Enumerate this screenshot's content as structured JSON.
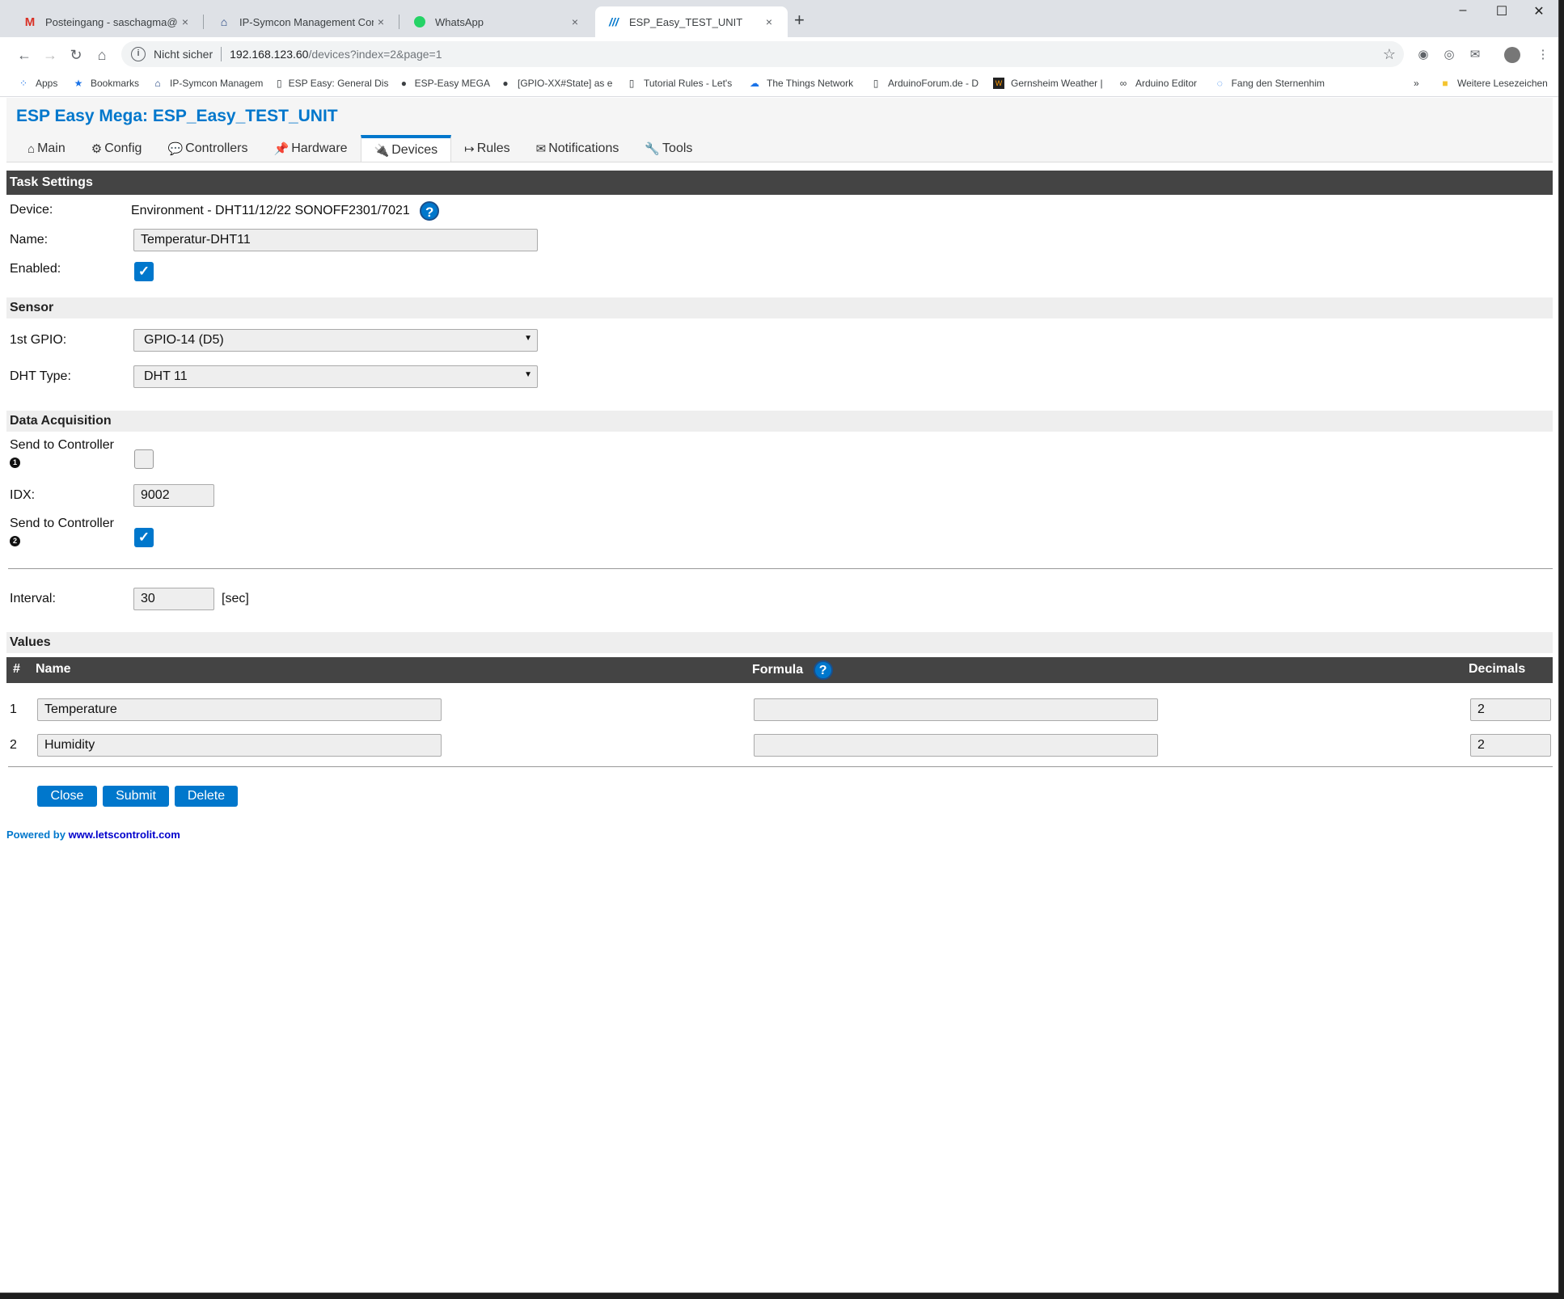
{
  "browser": {
    "tabs": [
      {
        "title": "Posteingang - saschagma@goog",
        "icon": "gmail-icon",
        "close": "×"
      },
      {
        "title": "IP-Symcon Management Console",
        "icon": "home-icon",
        "close": "×"
      },
      {
        "title": "WhatsApp",
        "icon": "whatsapp-icon",
        "close": "×"
      },
      {
        "title": "ESP_Easy_TEST_UNIT",
        "icon": "esp-icon",
        "close": "×"
      }
    ],
    "new_tab": "+",
    "address": {
      "security_label": "Nicht sicher",
      "host": "192.168.123.60",
      "path": "/devices?index=2&page=1"
    },
    "bookmarks": [
      {
        "label": "Apps",
        "icon": "apps-icon"
      },
      {
        "label": "Bookmarks",
        "icon": "star-icon"
      },
      {
        "label": "IP-Symcon Managem",
        "icon": "home-icon"
      },
      {
        "label": "ESP Easy: General Dis",
        "icon": "page-icon"
      },
      {
        "label": "ESP-Easy MEGA",
        "icon": "github-icon"
      },
      {
        "label": "[GPIO-XX#State] as e",
        "icon": "github-icon"
      },
      {
        "label": "Tutorial Rules - Let's",
        "icon": "page-icon"
      },
      {
        "label": "The Things Network",
        "icon": "cloud-icon"
      },
      {
        "label": "ArduinoForum.de - D",
        "icon": "page-icon"
      },
      {
        "label": "Gernsheim Weather |",
        "icon": "weather-icon"
      },
      {
        "label": "Arduino Editor",
        "icon": "arduino-icon"
      },
      {
        "label": "Fang den Sternenhim",
        "icon": "circle-icon"
      }
    ],
    "more_bookmarks": "»",
    "other_bookmarks": "Weitere Lesezeichen"
  },
  "app": {
    "title": "ESP Easy Mega: ESP_Easy_TEST_UNIT",
    "menu": [
      {
        "label": "Main",
        "icon": "⌂"
      },
      {
        "label": "Config",
        "icon": "⚙"
      },
      {
        "label": "Controllers",
        "icon": "💬"
      },
      {
        "label": "Hardware",
        "icon": "📌"
      },
      {
        "label": "Devices",
        "icon": "🔌"
      },
      {
        "label": "Rules",
        "icon": "↦"
      },
      {
        "label": "Notifications",
        "icon": "✉"
      },
      {
        "label": "Tools",
        "icon": "🔧"
      }
    ],
    "active_menu": "Devices",
    "accent_color": "#0077cc"
  },
  "task": {
    "section_title": "Task Settings",
    "device_label": "Device:",
    "device_value": "Environment - DHT11/12/22 SONOFF2301/7021",
    "help_glyph": "?",
    "name_label": "Name:",
    "name_value": "Temperatur-DHT11",
    "enabled_label": "Enabled:",
    "enabled": true,
    "check_glyph": "✓"
  },
  "sensor": {
    "section_title": "Sensor",
    "gpio_label": "1st GPIO:",
    "gpio_value": "GPIO-14 (D5)",
    "dht_label": "DHT Type:",
    "dht_value": "DHT 11",
    "arrow": "▼"
  },
  "acquisition": {
    "section_title": "Data Acquisition",
    "send1_label": "Send to Controller",
    "send1_badge": "1",
    "send1_checked": false,
    "idx_label": "IDX:",
    "idx_value": "9002",
    "send2_label": "Send to Controller",
    "send2_badge": "2",
    "send2_checked": true,
    "interval_label": "Interval:",
    "interval_value": "30",
    "interval_unit": "[sec]"
  },
  "values": {
    "section_title": "Values",
    "col_num": "#",
    "col_name": "Name",
    "col_formula": "Formula",
    "col_decimals": "Decimals",
    "rows": [
      {
        "num": "1",
        "name": "Temperature",
        "formula": "",
        "decimals": "2"
      },
      {
        "num": "2",
        "name": "Humidity",
        "formula": "",
        "decimals": "2"
      }
    ]
  },
  "buttons": {
    "close": "Close",
    "submit": "Submit",
    "delete": "Delete"
  },
  "footer": {
    "powered_by": "Powered by",
    "link": "www.letscontrolit.com"
  }
}
